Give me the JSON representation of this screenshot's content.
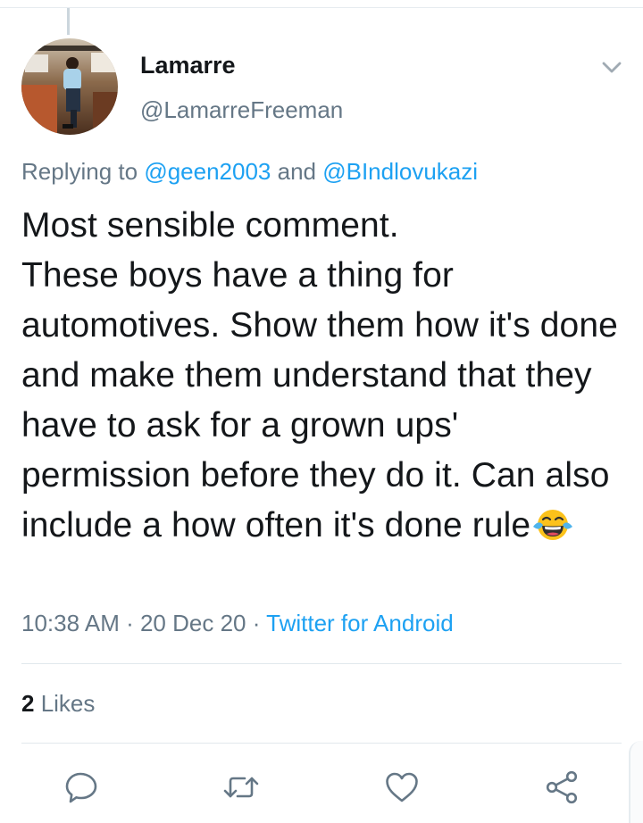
{
  "tweet": {
    "author_name": "Lamarre",
    "author_handle": "@LamarreFreeman",
    "replying_prefix": "Replying to ",
    "replying_to": [
      "@geen2003",
      "@BIndlovukazi"
    ],
    "replying_joiner": " and ",
    "text": "Most sensible comment.\nThese boys have a thing for automotives. Show them how it's done and make them understand that they have to ask for a grown ups' permission before they do it. Can also include a how often it's done rule",
    "text_emoji": "face-with-tears-of-joy",
    "time": "10:38 AM",
    "separator": " · ",
    "date": "20 Dec 20",
    "source": "Twitter for Android"
  },
  "stats": {
    "likes_count": "2",
    "likes_label": " Likes"
  },
  "actions": [
    {
      "name": "reply",
      "icon": "speech-bubble-icon"
    },
    {
      "name": "retweet",
      "icon": "retweet-icon"
    },
    {
      "name": "like",
      "icon": "heart-icon"
    },
    {
      "name": "share",
      "icon": "share-icon"
    }
  ],
  "colors": {
    "accent": "#1da1f2",
    "secondary_text": "#657786",
    "primary_text": "#14171a",
    "icon": "#657786",
    "divider": "#e1e8ed"
  }
}
